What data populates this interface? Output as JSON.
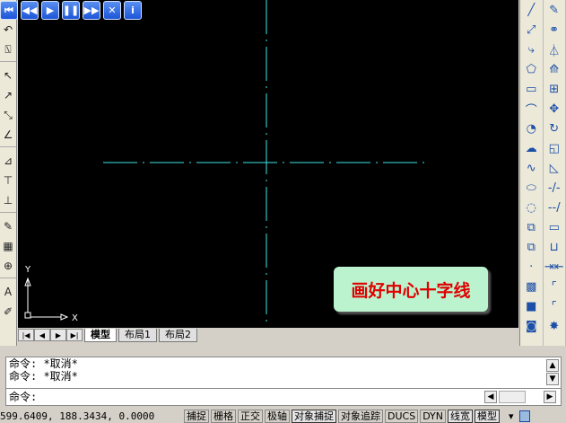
{
  "anim_toolbar": [
    {
      "icon": "skip-start-icon",
      "glyph": "⏮"
    },
    {
      "icon": "rewind-icon",
      "glyph": "◀◀"
    },
    {
      "icon": "play-icon",
      "glyph": "▶"
    },
    {
      "icon": "pause-icon",
      "glyph": "❚❚"
    },
    {
      "icon": "fast-forward-icon",
      "glyph": "▶▶"
    },
    {
      "icon": "close-icon",
      "glyph": "✕"
    },
    {
      "icon": "info-icon",
      "glyph": "i"
    }
  ],
  "left_toolbar": [
    "↘",
    "↶",
    "⍂",
    "|",
    "↖",
    "↗",
    "⤡",
    "∠",
    "|",
    "⊿",
    "⊤",
    "⊥",
    "|",
    "✎",
    "▦",
    "⊕",
    "|",
    "A",
    "✐"
  ],
  "right_toolbar": {
    "col1": [
      "╱",
      "⤢",
      "⤷",
      "⬠",
      "▭",
      "⌒",
      "◔",
      "☁",
      "∿",
      "⬭",
      "◌",
      "⧉",
      "⧉",
      "·",
      "▩",
      "■",
      "◙"
    ],
    "col2": [
      "✎",
      "⚭",
      "⏃",
      "⟰",
      "⊞",
      "✥",
      "↻",
      "◱",
      "◺",
      "-/-",
      "--/",
      "▭",
      "⊔",
      "⇥⇤",
      "⌜",
      "⌜",
      "✸"
    ]
  },
  "canvas": {
    "label": "画好中心十字线",
    "ucs_x": "X",
    "ucs_y": "Y",
    "line_color": "#3ee6e6"
  },
  "tabs": {
    "model": "模型",
    "layout1": "布局1",
    "layout2": "布局2"
  },
  "command": {
    "history": [
      "命令: *取消*",
      "命令: *取消*"
    ],
    "prompt": "命令:"
  },
  "status": {
    "coords": "599.6409, 188.3434, 0.0000",
    "buttons": [
      {
        "label": "捕捉",
        "on": false
      },
      {
        "label": "栅格",
        "on": false
      },
      {
        "label": "正交",
        "on": false
      },
      {
        "label": "极轴",
        "on": false
      },
      {
        "label": "对象捕捉",
        "on": true
      },
      {
        "label": "对象追踪",
        "on": false
      },
      {
        "label": "DUCS",
        "on": false
      },
      {
        "label": "DYN",
        "on": false
      },
      {
        "label": "线宽",
        "on": true
      },
      {
        "label": "模型",
        "on": true
      }
    ]
  }
}
